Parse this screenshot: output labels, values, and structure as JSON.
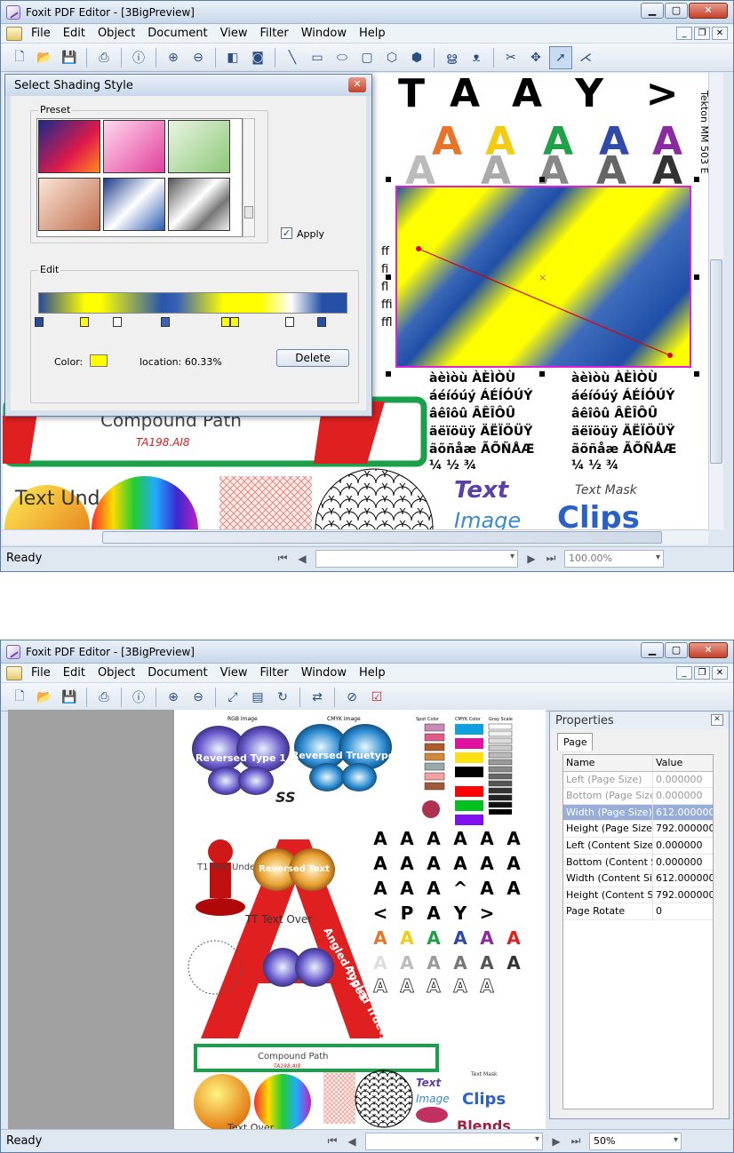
{
  "window1": {
    "title": "Foxit PDF Editor - [3BigPreview]",
    "menus": [
      "File",
      "Edit",
      "Object",
      "Document",
      "View",
      "Filter",
      "Window",
      "Help"
    ],
    "status": "Ready",
    "zoom": "100.00%",
    "dialog": {
      "title": "Select Shading Style",
      "preset_label": "Preset",
      "apply_label": "Apply",
      "apply_checked": true,
      "edit_label": "Edit",
      "color_label": "Color:",
      "location_text": "location: 60.33%",
      "delete_label": "Delete",
      "selected_color": "#ffff00"
    },
    "canvas": {
      "side_text": "Tekton MM 503 E",
      "compound_text": "Compound Path",
      "filename_text": "TA198.AI8",
      "accent_lines": [
        "àèìòù ÀÈÌÒÙ",
        "áéíóúý ÁÉÍÓÚÝ",
        "âêîôû ÂÊÎÔÛ",
        "äëïöüÿ ÄËÏÖÜŸ",
        "ãõñåæ ÃÕÑÅÆ",
        "¼ ½ ¾"
      ],
      "text_label": "Text",
      "image_label": "Image",
      "mask_label": "Text Mask",
      "clips_label": "Clips",
      "text_under": "Text Und"
    }
  },
  "window2": {
    "title": "Foxit PDF Editor - [3BigPreview]",
    "menus": [
      "File",
      "Edit",
      "Object",
      "Document",
      "View",
      "Filter",
      "Window",
      "Help"
    ],
    "status": "Ready",
    "zoom": "50%",
    "properties": {
      "title": "Properties",
      "tab": "Page",
      "col_name": "Name",
      "col_value": "Value",
      "rows": [
        {
          "name": "Left (Page Size)",
          "value": "0.000000"
        },
        {
          "name": "Bottom (Page Size)",
          "value": "0.000000"
        },
        {
          "name": "Width (Page Size)",
          "value": "612.000000"
        },
        {
          "name": "Height (Page Size)",
          "value": "792.000000"
        },
        {
          "name": "Left (Content Size)",
          "value": "0.000000"
        },
        {
          "name": "Bottom (Content Size)",
          "value": "0.000000"
        },
        {
          "name": "Width (Content Size)",
          "value": "612.000000"
        },
        {
          "name": "Height (Content Size)",
          "value": "792.000000"
        },
        {
          "name": "Page Rotate",
          "value": "0"
        }
      ]
    },
    "page": {
      "reversed_type1": "Reversed Type 1",
      "reversed_truetype": "Reversed Truetype",
      "reversed_text": "Reversed Text",
      "angled_type1": "Angled Type1",
      "angled_truetype": "Angled Truetype",
      "t1_text": "T1 Text Under T1 Text Over",
      "tt_text": "TT Text Over",
      "compound_text": "Compound Path",
      "filename_text": "TA198.AI8",
      "text_label": "Text",
      "image_label": "Image",
      "clips_label": "Clips",
      "blends_label": "Blends",
      "text_mask": "Text Mask",
      "text_over": "Text Over",
      "spot_color": "Spot Color",
      "cmyk_color": "CMYK Color",
      "gray_scale": "Gray Scale",
      "rgb_image": "RGB Image",
      "cmyk_image": "CMYK Image"
    }
  }
}
